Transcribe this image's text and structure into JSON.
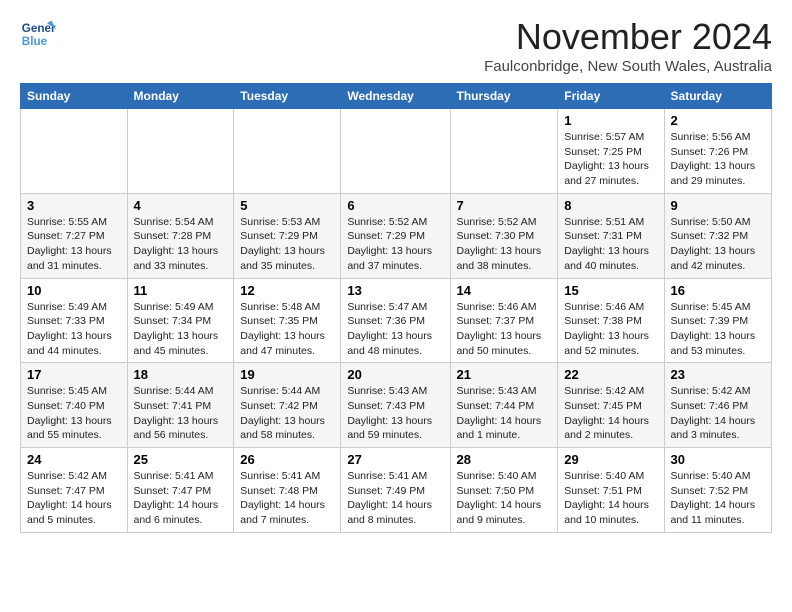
{
  "logo": {
    "line1": "General",
    "line2": "Blue"
  },
  "title": "November 2024",
  "location": "Faulconbridge, New South Wales, Australia",
  "days_of_week": [
    "Sunday",
    "Monday",
    "Tuesday",
    "Wednesday",
    "Thursday",
    "Friday",
    "Saturday"
  ],
  "weeks": [
    [
      {
        "day": "",
        "info": ""
      },
      {
        "day": "",
        "info": ""
      },
      {
        "day": "",
        "info": ""
      },
      {
        "day": "",
        "info": ""
      },
      {
        "day": "",
        "info": ""
      },
      {
        "day": "1",
        "info": "Sunrise: 5:57 AM\nSunset: 7:25 PM\nDaylight: 13 hours\nand 27 minutes."
      },
      {
        "day": "2",
        "info": "Sunrise: 5:56 AM\nSunset: 7:26 PM\nDaylight: 13 hours\nand 29 minutes."
      }
    ],
    [
      {
        "day": "3",
        "info": "Sunrise: 5:55 AM\nSunset: 7:27 PM\nDaylight: 13 hours\nand 31 minutes."
      },
      {
        "day": "4",
        "info": "Sunrise: 5:54 AM\nSunset: 7:28 PM\nDaylight: 13 hours\nand 33 minutes."
      },
      {
        "day": "5",
        "info": "Sunrise: 5:53 AM\nSunset: 7:29 PM\nDaylight: 13 hours\nand 35 minutes."
      },
      {
        "day": "6",
        "info": "Sunrise: 5:52 AM\nSunset: 7:29 PM\nDaylight: 13 hours\nand 37 minutes."
      },
      {
        "day": "7",
        "info": "Sunrise: 5:52 AM\nSunset: 7:30 PM\nDaylight: 13 hours\nand 38 minutes."
      },
      {
        "day": "8",
        "info": "Sunrise: 5:51 AM\nSunset: 7:31 PM\nDaylight: 13 hours\nand 40 minutes."
      },
      {
        "day": "9",
        "info": "Sunrise: 5:50 AM\nSunset: 7:32 PM\nDaylight: 13 hours\nand 42 minutes."
      }
    ],
    [
      {
        "day": "10",
        "info": "Sunrise: 5:49 AM\nSunset: 7:33 PM\nDaylight: 13 hours\nand 44 minutes."
      },
      {
        "day": "11",
        "info": "Sunrise: 5:49 AM\nSunset: 7:34 PM\nDaylight: 13 hours\nand 45 minutes."
      },
      {
        "day": "12",
        "info": "Sunrise: 5:48 AM\nSunset: 7:35 PM\nDaylight: 13 hours\nand 47 minutes."
      },
      {
        "day": "13",
        "info": "Sunrise: 5:47 AM\nSunset: 7:36 PM\nDaylight: 13 hours\nand 48 minutes."
      },
      {
        "day": "14",
        "info": "Sunrise: 5:46 AM\nSunset: 7:37 PM\nDaylight: 13 hours\nand 50 minutes."
      },
      {
        "day": "15",
        "info": "Sunrise: 5:46 AM\nSunset: 7:38 PM\nDaylight: 13 hours\nand 52 minutes."
      },
      {
        "day": "16",
        "info": "Sunrise: 5:45 AM\nSunset: 7:39 PM\nDaylight: 13 hours\nand 53 minutes."
      }
    ],
    [
      {
        "day": "17",
        "info": "Sunrise: 5:45 AM\nSunset: 7:40 PM\nDaylight: 13 hours\nand 55 minutes."
      },
      {
        "day": "18",
        "info": "Sunrise: 5:44 AM\nSunset: 7:41 PM\nDaylight: 13 hours\nand 56 minutes."
      },
      {
        "day": "19",
        "info": "Sunrise: 5:44 AM\nSunset: 7:42 PM\nDaylight: 13 hours\nand 58 minutes."
      },
      {
        "day": "20",
        "info": "Sunrise: 5:43 AM\nSunset: 7:43 PM\nDaylight: 13 hours\nand 59 minutes."
      },
      {
        "day": "21",
        "info": "Sunrise: 5:43 AM\nSunset: 7:44 PM\nDaylight: 14 hours\nand 1 minute."
      },
      {
        "day": "22",
        "info": "Sunrise: 5:42 AM\nSunset: 7:45 PM\nDaylight: 14 hours\nand 2 minutes."
      },
      {
        "day": "23",
        "info": "Sunrise: 5:42 AM\nSunset: 7:46 PM\nDaylight: 14 hours\nand 3 minutes."
      }
    ],
    [
      {
        "day": "24",
        "info": "Sunrise: 5:42 AM\nSunset: 7:47 PM\nDaylight: 14 hours\nand 5 minutes."
      },
      {
        "day": "25",
        "info": "Sunrise: 5:41 AM\nSunset: 7:47 PM\nDaylight: 14 hours\nand 6 minutes."
      },
      {
        "day": "26",
        "info": "Sunrise: 5:41 AM\nSunset: 7:48 PM\nDaylight: 14 hours\nand 7 minutes."
      },
      {
        "day": "27",
        "info": "Sunrise: 5:41 AM\nSunset: 7:49 PM\nDaylight: 14 hours\nand 8 minutes."
      },
      {
        "day": "28",
        "info": "Sunrise: 5:40 AM\nSunset: 7:50 PM\nDaylight: 14 hours\nand 9 minutes."
      },
      {
        "day": "29",
        "info": "Sunrise: 5:40 AM\nSunset: 7:51 PM\nDaylight: 14 hours\nand 10 minutes."
      },
      {
        "day": "30",
        "info": "Sunrise: 5:40 AM\nSunset: 7:52 PM\nDaylight: 14 hours\nand 11 minutes."
      }
    ]
  ]
}
